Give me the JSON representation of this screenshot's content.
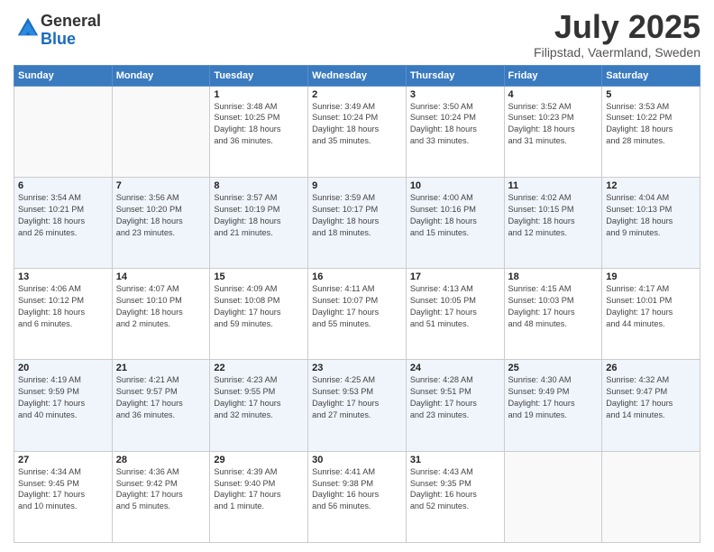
{
  "header": {
    "logo_line1": "General",
    "logo_line2": "Blue",
    "month": "July 2025",
    "location": "Filipstad, Vaermland, Sweden"
  },
  "weekdays": [
    "Sunday",
    "Monday",
    "Tuesday",
    "Wednesday",
    "Thursday",
    "Friday",
    "Saturday"
  ],
  "weeks": [
    [
      {
        "day": "",
        "text": ""
      },
      {
        "day": "",
        "text": ""
      },
      {
        "day": "1",
        "text": "Sunrise: 3:48 AM\nSunset: 10:25 PM\nDaylight: 18 hours\nand 36 minutes."
      },
      {
        "day": "2",
        "text": "Sunrise: 3:49 AM\nSunset: 10:24 PM\nDaylight: 18 hours\nand 35 minutes."
      },
      {
        "day": "3",
        "text": "Sunrise: 3:50 AM\nSunset: 10:24 PM\nDaylight: 18 hours\nand 33 minutes."
      },
      {
        "day": "4",
        "text": "Sunrise: 3:52 AM\nSunset: 10:23 PM\nDaylight: 18 hours\nand 31 minutes."
      },
      {
        "day": "5",
        "text": "Sunrise: 3:53 AM\nSunset: 10:22 PM\nDaylight: 18 hours\nand 28 minutes."
      }
    ],
    [
      {
        "day": "6",
        "text": "Sunrise: 3:54 AM\nSunset: 10:21 PM\nDaylight: 18 hours\nand 26 minutes."
      },
      {
        "day": "7",
        "text": "Sunrise: 3:56 AM\nSunset: 10:20 PM\nDaylight: 18 hours\nand 23 minutes."
      },
      {
        "day": "8",
        "text": "Sunrise: 3:57 AM\nSunset: 10:19 PM\nDaylight: 18 hours\nand 21 minutes."
      },
      {
        "day": "9",
        "text": "Sunrise: 3:59 AM\nSunset: 10:17 PM\nDaylight: 18 hours\nand 18 minutes."
      },
      {
        "day": "10",
        "text": "Sunrise: 4:00 AM\nSunset: 10:16 PM\nDaylight: 18 hours\nand 15 minutes."
      },
      {
        "day": "11",
        "text": "Sunrise: 4:02 AM\nSunset: 10:15 PM\nDaylight: 18 hours\nand 12 minutes."
      },
      {
        "day": "12",
        "text": "Sunrise: 4:04 AM\nSunset: 10:13 PM\nDaylight: 18 hours\nand 9 minutes."
      }
    ],
    [
      {
        "day": "13",
        "text": "Sunrise: 4:06 AM\nSunset: 10:12 PM\nDaylight: 18 hours\nand 6 minutes."
      },
      {
        "day": "14",
        "text": "Sunrise: 4:07 AM\nSunset: 10:10 PM\nDaylight: 18 hours\nand 2 minutes."
      },
      {
        "day": "15",
        "text": "Sunrise: 4:09 AM\nSunset: 10:08 PM\nDaylight: 17 hours\nand 59 minutes."
      },
      {
        "day": "16",
        "text": "Sunrise: 4:11 AM\nSunset: 10:07 PM\nDaylight: 17 hours\nand 55 minutes."
      },
      {
        "day": "17",
        "text": "Sunrise: 4:13 AM\nSunset: 10:05 PM\nDaylight: 17 hours\nand 51 minutes."
      },
      {
        "day": "18",
        "text": "Sunrise: 4:15 AM\nSunset: 10:03 PM\nDaylight: 17 hours\nand 48 minutes."
      },
      {
        "day": "19",
        "text": "Sunrise: 4:17 AM\nSunset: 10:01 PM\nDaylight: 17 hours\nand 44 minutes."
      }
    ],
    [
      {
        "day": "20",
        "text": "Sunrise: 4:19 AM\nSunset: 9:59 PM\nDaylight: 17 hours\nand 40 minutes."
      },
      {
        "day": "21",
        "text": "Sunrise: 4:21 AM\nSunset: 9:57 PM\nDaylight: 17 hours\nand 36 minutes."
      },
      {
        "day": "22",
        "text": "Sunrise: 4:23 AM\nSunset: 9:55 PM\nDaylight: 17 hours\nand 32 minutes."
      },
      {
        "day": "23",
        "text": "Sunrise: 4:25 AM\nSunset: 9:53 PM\nDaylight: 17 hours\nand 27 minutes."
      },
      {
        "day": "24",
        "text": "Sunrise: 4:28 AM\nSunset: 9:51 PM\nDaylight: 17 hours\nand 23 minutes."
      },
      {
        "day": "25",
        "text": "Sunrise: 4:30 AM\nSunset: 9:49 PM\nDaylight: 17 hours\nand 19 minutes."
      },
      {
        "day": "26",
        "text": "Sunrise: 4:32 AM\nSunset: 9:47 PM\nDaylight: 17 hours\nand 14 minutes."
      }
    ],
    [
      {
        "day": "27",
        "text": "Sunrise: 4:34 AM\nSunset: 9:45 PM\nDaylight: 17 hours\nand 10 minutes."
      },
      {
        "day": "28",
        "text": "Sunrise: 4:36 AM\nSunset: 9:42 PM\nDaylight: 17 hours\nand 5 minutes."
      },
      {
        "day": "29",
        "text": "Sunrise: 4:39 AM\nSunset: 9:40 PM\nDaylight: 17 hours\nand 1 minute."
      },
      {
        "day": "30",
        "text": "Sunrise: 4:41 AM\nSunset: 9:38 PM\nDaylight: 16 hours\nand 56 minutes."
      },
      {
        "day": "31",
        "text": "Sunrise: 4:43 AM\nSunset: 9:35 PM\nDaylight: 16 hours\nand 52 minutes."
      },
      {
        "day": "",
        "text": ""
      },
      {
        "day": "",
        "text": ""
      }
    ]
  ]
}
